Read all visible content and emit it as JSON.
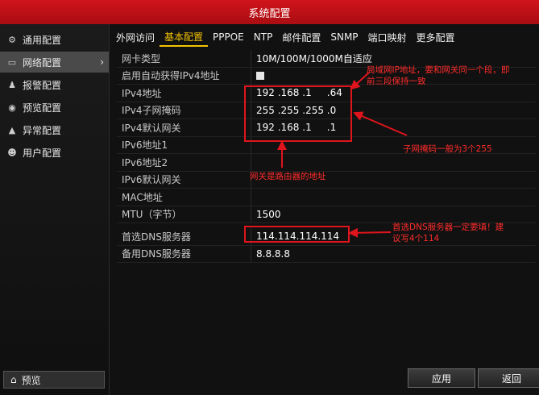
{
  "window": {
    "title": "系统配置"
  },
  "sidebar": {
    "items": [
      {
        "label": "通用配置",
        "icon": "gear-icon"
      },
      {
        "label": "网络配置",
        "icon": "network-icon",
        "active": true
      },
      {
        "label": "报警配置",
        "icon": "alarm-icon"
      },
      {
        "label": "预览配置",
        "icon": "eye-icon"
      },
      {
        "label": "异常配置",
        "icon": "warning-icon"
      },
      {
        "label": "用户配置",
        "icon": "users-icon"
      }
    ],
    "bottom_button": {
      "label": "预览",
      "icon": "home-icon"
    }
  },
  "tabs": [
    "外网访问",
    "基本配置",
    "PPPOE",
    "NTP",
    "邮件配置",
    "SNMP",
    "端口映射",
    "更多配置"
  ],
  "active_tab": "基本配置",
  "form": {
    "nic_type": {
      "label": "网卡类型",
      "value": "10M/100M/1000M自适应"
    },
    "dhcp": {
      "label": "启用自动获得IPv4地址"
    },
    "ipv4_addr": {
      "label": "IPv4地址",
      "value": "192 .168 .1     .64"
    },
    "ipv4_mask": {
      "label": "IPv4子网掩码",
      "value": "255 .255 .255 .0"
    },
    "ipv4_gw": {
      "label": "IPv4默认网关",
      "value": "192 .168 .1     .1"
    },
    "ipv6_addr1": {
      "label": "IPv6地址1"
    },
    "ipv6_addr2": {
      "label": "IPv6地址2"
    },
    "ipv6_gw": {
      "label": "IPv6默认网关"
    },
    "mac": {
      "label": "MAC地址"
    },
    "mtu": {
      "label": "MTU（字节）",
      "value": "1500"
    },
    "dns1": {
      "label": "首选DNS服务器",
      "value": "114.114.114.114"
    },
    "dns2": {
      "label": "备用DNS服务器",
      "value": "8.8.8.8"
    }
  },
  "annotations": {
    "ip_note": "局域网IP地址，要和网关同一个段，即前三段保持一致",
    "mask_note": "子网掩码一般为3个255",
    "gw_note": "网关是路由器的地址",
    "dns_note": "首选DNS服务器一定要填！建议写4个114",
    "color": "#ff2b2b"
  },
  "buttons": {
    "apply": "应用",
    "back": "返回"
  }
}
